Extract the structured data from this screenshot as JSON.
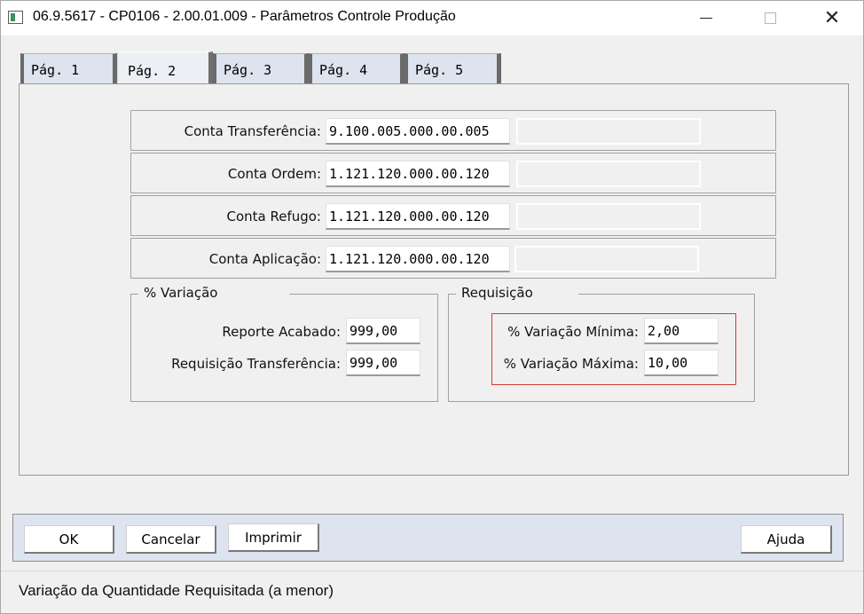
{
  "window": {
    "title": "06.9.5617 - CP0106 - 2.00.01.009 - Parâmetros Controle Produção",
    "minimize_glyph": "—",
    "maximize_glyph": "☐",
    "close_glyph": "✕"
  },
  "tabs": [
    {
      "label": "Pág. 1",
      "active": false
    },
    {
      "label": "Pág. 2",
      "active": true
    },
    {
      "label": "Pág. 3",
      "active": false
    },
    {
      "label": "Pág. 4",
      "active": false
    },
    {
      "label": "Pág. 5",
      "active": false
    }
  ],
  "accounts": [
    {
      "label": "Conta Transferência:",
      "code": "9.100.005.000.00.005",
      "description": ""
    },
    {
      "label": "Conta Ordem:",
      "code": "1.121.120.000.00.120",
      "description": ""
    },
    {
      "label": "Conta Refugo:",
      "code": "1.121.120.000.00.120",
      "description": ""
    },
    {
      "label": "Conta Aplicação:",
      "code": "1.121.120.000.00.120",
      "description": ""
    }
  ],
  "variacao": {
    "title": "% Variação",
    "reporte_acabado_label": "Reporte Acabado:",
    "reporte_acabado_value": "999,00",
    "requisicao_transferencia_label": "Requisição Transferência:",
    "requisicao_transferencia_value": "999,00"
  },
  "requisicao": {
    "title": "Requisição",
    "variacao_minima_label": "% Variação Mínima:",
    "variacao_minima_value": "2,00",
    "variacao_maxima_label": "% Variação Máxima:",
    "variacao_maxima_value": "10,00"
  },
  "buttons": {
    "ok": "OK",
    "cancel": "Cancelar",
    "print": "Imprimir",
    "help": "Ajuda"
  },
  "status": "Variação da Quantidade Requisitada (a menor)",
  "colors": {
    "highlight": "#d23a3a",
    "tab_bg": "#dde4ef",
    "button_bar_bg": "#dde4ef"
  }
}
